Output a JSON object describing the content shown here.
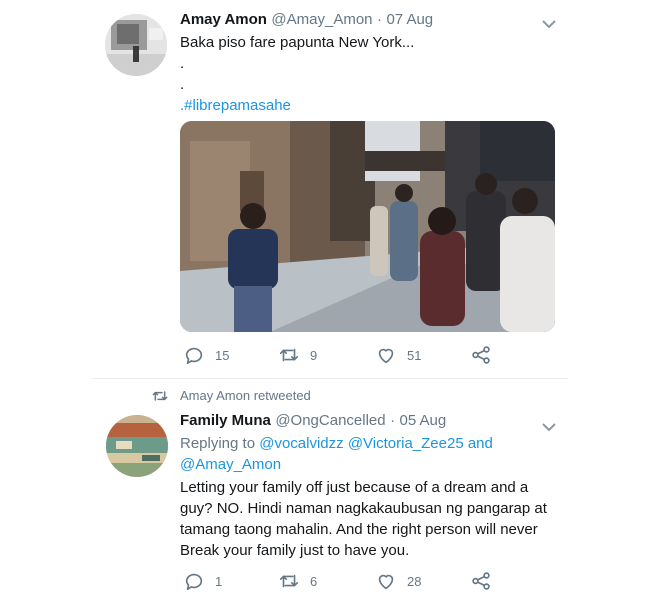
{
  "tweet1": {
    "author": "Amay Amon",
    "handle": "@Amay_Amon",
    "sep": "·",
    "date": "07 Aug",
    "line1": "Baka piso fare papunta New York...",
    "line2": ".",
    "line3": ".",
    "hashtag": ".#librepamasahe",
    "stats": {
      "replies": "15",
      "retweets": "9",
      "likes": "51"
    }
  },
  "retweet_context": {
    "label": "Amay Amon retweeted"
  },
  "tweet2": {
    "author": "Family Muna",
    "handle": "@OngCancelled",
    "sep": "·",
    "date": "05 Aug",
    "replying_label": "Replying to",
    "replying_users": [
      "@vocalvidzz",
      "@Victoria_Zee25"
    ],
    "and": "and",
    "replying_last": "@Amay_Amon",
    "body": [
      "Letting your family off just because of a dream and a",
      "guy? NO. Hindi naman nagkakaubusan ng pangarap at",
      "tamang taong mahalin. And the right person will never",
      "Break your family just to have you."
    ],
    "stats": {
      "replies": "1",
      "retweets": "6",
      "likes": "28"
    }
  },
  "icons": {
    "reply": "reply-icon",
    "retweet": "retweet-icon",
    "like": "heart-icon",
    "share": "share-icon",
    "more": "chevron-down-icon"
  },
  "colors": {
    "link": "#1b95e0",
    "secondary": "#657786",
    "divider": "#e6ecf0"
  }
}
